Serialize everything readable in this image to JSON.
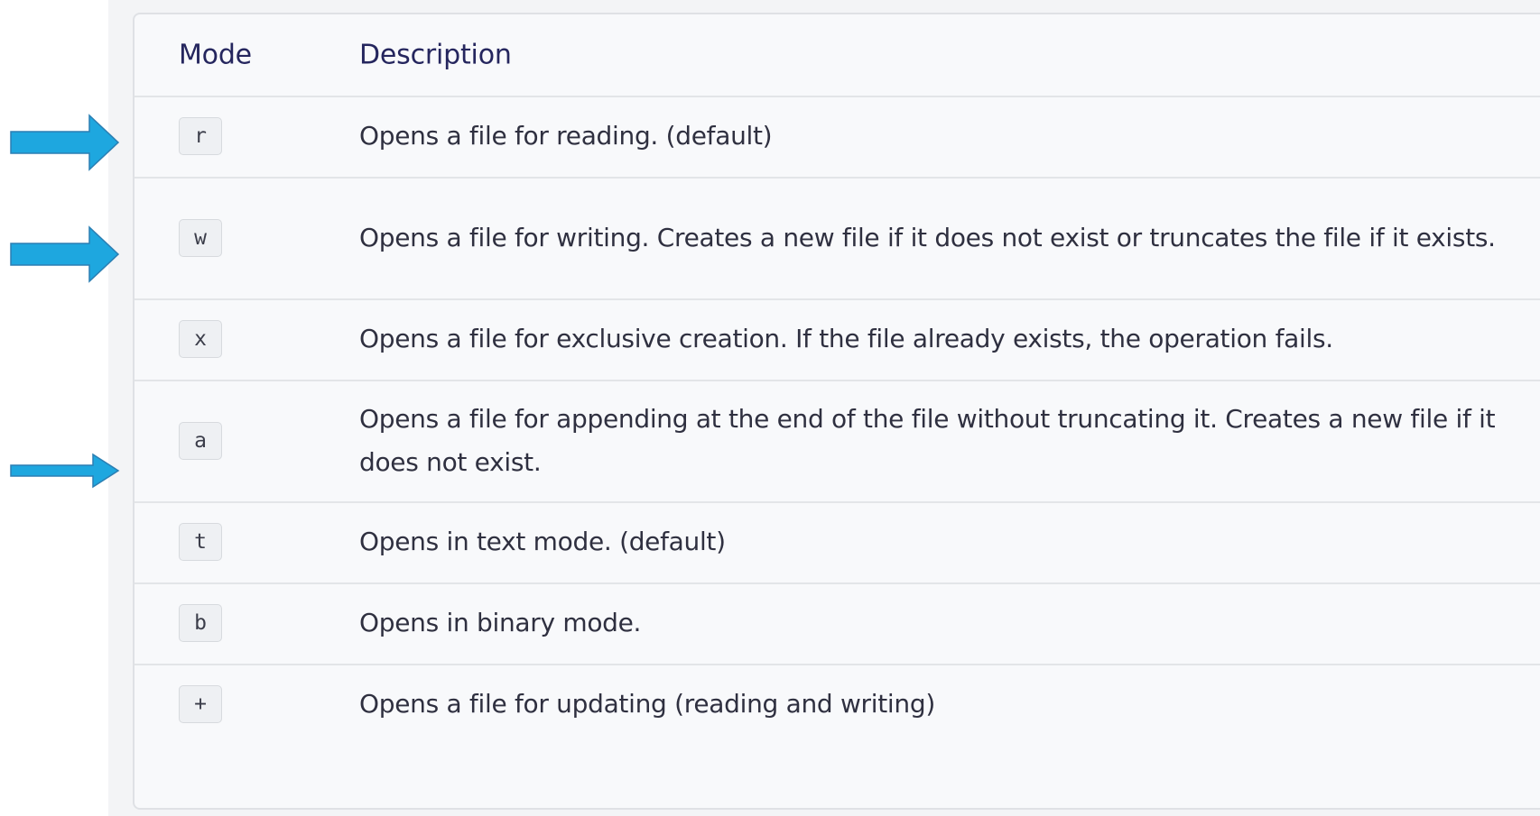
{
  "table": {
    "header": {
      "mode": "Mode",
      "description": "Description"
    },
    "rows": [
      {
        "mode": "r",
        "description": "Opens a file for reading. (default)"
      },
      {
        "mode": "w",
        "description": "Opens a file for writing. Creates a new file if it does not exist or truncates the file if it exists."
      },
      {
        "mode": "x",
        "description": "Opens a file for exclusive creation. If the file already exists, the operation fails."
      },
      {
        "mode": "a",
        "description": "Opens a file for appending at the end of the file without truncating it. Creates a new file if it does not exist."
      },
      {
        "mode": "t",
        "description": "Opens in text mode. (default)"
      },
      {
        "mode": "b",
        "description": "Opens in binary mode."
      },
      {
        "mode": "+",
        "description": "Opens a file for updating (reading and writing)"
      }
    ]
  },
  "annotations": {
    "arrow_color": "#1ea7df",
    "arrow_outline_color": "#2b7fb3",
    "highlighted_modes": [
      "r",
      "w",
      "a"
    ]
  }
}
